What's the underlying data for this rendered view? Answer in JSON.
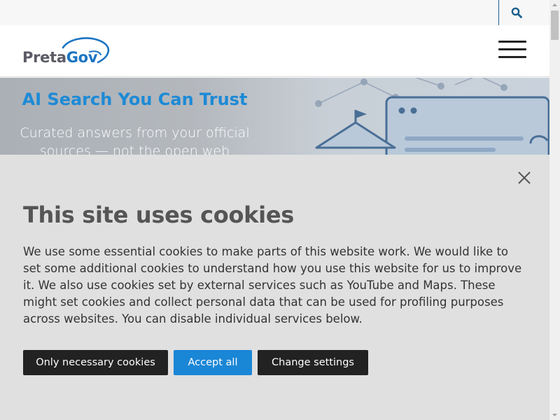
{
  "topbar": {
    "search_icon": "search-icon",
    "accent": "#1c5f8c"
  },
  "header": {
    "logo_part1": "Preta",
    "logo_part2": "Gov",
    "menu_icon": "hamburger-menu-icon"
  },
  "hero": {
    "title": "AI Search You Can Trust",
    "subtitle": "Curated answers from your official sources — not the open web",
    "title_color": "#1d8ad6"
  },
  "cookie_banner": {
    "title": "This site uses cookies",
    "body": "We use some essential cookies to make parts of this website work. We would like to set some additional cookies to understand how you use this website for us to improve it. We also use cookies set by external services such as YouTube and Maps. These might set cookies and collect personal data that can be used for profiling purposes across websites. You can disable individual services below.",
    "buttons": {
      "necessary": "Only necessary cookies",
      "accept": "Accept all",
      "settings": "Change settings"
    },
    "close_icon": "close-icon",
    "accent": "#1a86d6"
  }
}
